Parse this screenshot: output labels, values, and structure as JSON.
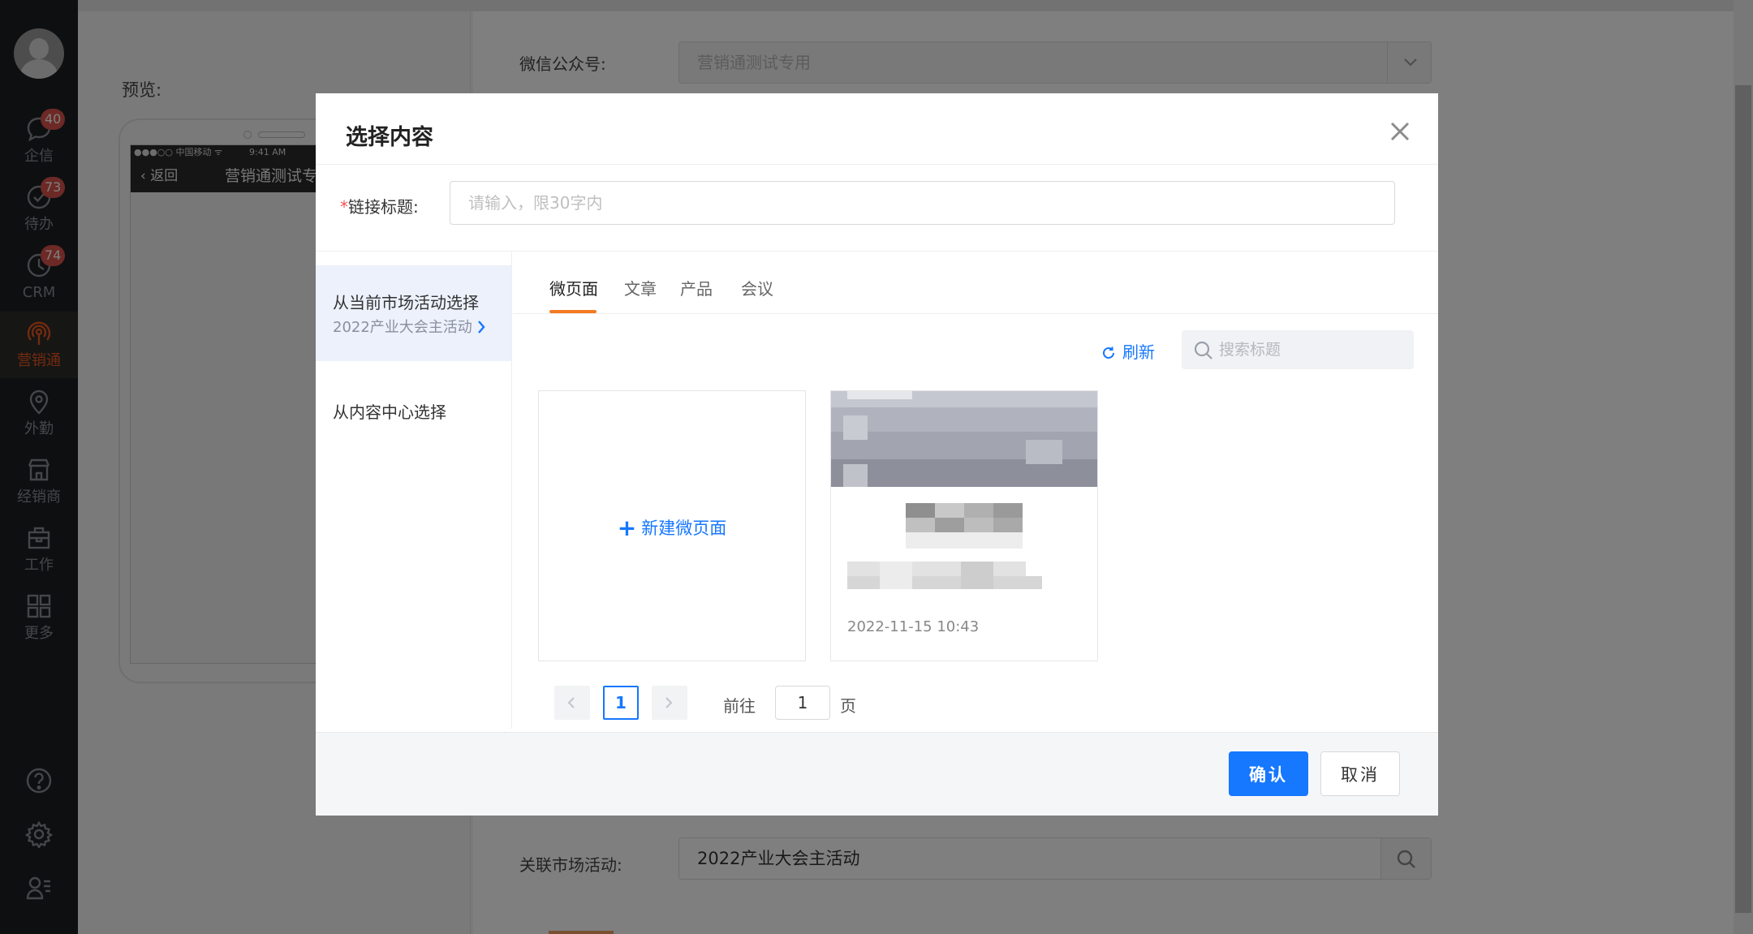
{
  "sidebar": {
    "items": [
      {
        "label": "企信",
        "badge": "40",
        "icon": "chat-bubble-icon"
      },
      {
        "label": "待办",
        "badge": "73",
        "icon": "check-circle-icon"
      },
      {
        "label": "CRM",
        "badge": "74",
        "icon": "clock-icon"
      },
      {
        "label": "营销通",
        "badge": "",
        "icon": "broadcast-icon",
        "active": true
      },
      {
        "label": "外勤",
        "badge": "",
        "icon": "location-pin-icon"
      },
      {
        "label": "经销商",
        "badge": "",
        "icon": "store-icon"
      },
      {
        "label": "工作",
        "badge": "",
        "icon": "briefcase-icon"
      },
      {
        "label": "更多",
        "badge": "",
        "icon": "grid-icon"
      }
    ],
    "bottom_icons": [
      "help-icon",
      "settings-icon",
      "user-list-icon"
    ]
  },
  "background": {
    "preview_label": "预览:",
    "phone": {
      "status_carrier": "●●●○○ 中国移动 ᯤ",
      "status_time": "9:41 AM",
      "nav_back": "返回",
      "nav_title": "营销通测试专用"
    },
    "wechat_label": "微信公众号:",
    "wechat_value": "营销通测试专用",
    "campaign_label": "关联市场活动:",
    "campaign_value": "2022产业大会主活动"
  },
  "modal": {
    "title": "选择内容",
    "link_title_required": "*",
    "link_title_label": "链接标题:",
    "link_title_placeholder": "请输入，限30字内",
    "sources": [
      {
        "title": "从当前市场活动选择",
        "subtitle": "2022产业大会主活动"
      },
      {
        "title": "从内容中心选择"
      }
    ],
    "tabs": [
      "微页面",
      "文章",
      "产品",
      "会议"
    ],
    "active_tab": "微页面",
    "refresh_label": "刷新",
    "search_placeholder": "搜索标题",
    "new_card_label": "新建微页面",
    "new_card_plus": "+",
    "items": [
      {
        "date": "2022-11-15 10:43"
      }
    ],
    "pagination": {
      "current": "1",
      "goto_label": "前往",
      "goto_value": "1",
      "page_suffix": "页"
    },
    "confirm_label": "确认",
    "cancel_label": "取消"
  },
  "colors": {
    "accent": "#1677ff",
    "active_tab_underline": "#f47b20",
    "nav_active": "#e8541e",
    "badge": "#d9534a",
    "sidebar_bg": "#1d1e22"
  }
}
